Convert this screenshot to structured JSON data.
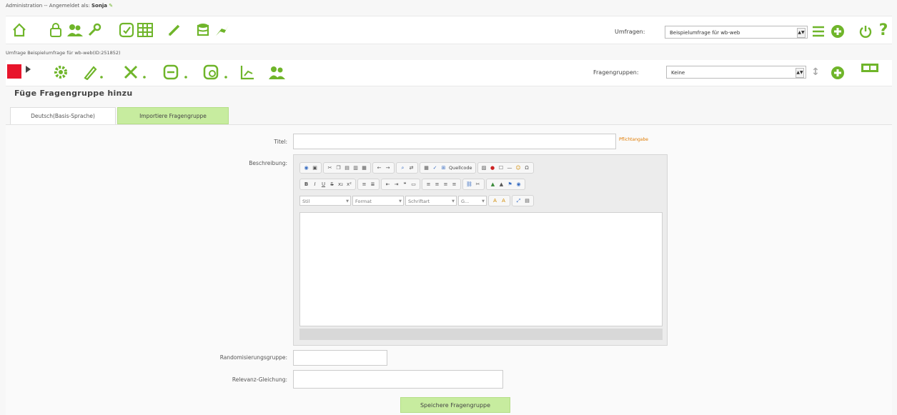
{
  "breadcrumb": {
    "admin": "Administration",
    "separator": " -- ",
    "logged_in_as": "Angemeldet als:",
    "username": "Sonja"
  },
  "toolbar_main": {
    "icons": [
      "home-icon",
      "lock-icon",
      "user-group-icon",
      "wrench-icon",
      "survey-icon",
      "grid-icon",
      "pencil-icon",
      "database-icon",
      "plugin-icon"
    ],
    "surveys_label": "Umfragen:",
    "survey_select": "Beispielumfrage für wb-web",
    "right_icons": [
      "list-icon",
      "add-icon",
      "power-icon",
      "help-icon"
    ]
  },
  "survey_info": "Umfrage Beispielumfrage für wb-web(ID:251852)",
  "toolbar_survey": {
    "icons": [
      "stop-icon",
      "play-icon",
      "settings-icon",
      "edit-icon",
      "tools-icon",
      "survey-group-icon",
      "survey-refresh-icon",
      "chart-icon",
      "people-icon"
    ],
    "groups_label": "Fragengruppen:",
    "group_select": "Keine",
    "right_icons": [
      "reorder-icon",
      "add-group-icon",
      "display-icon"
    ]
  },
  "page_title": "Füge Fragengruppe hinzu",
  "tabs": [
    "Deutsch(Basis-Sprache)",
    "Importiere Fragengruppe"
  ],
  "form": {
    "title_label": "Titel:",
    "required_label": "Pflichtangabe",
    "description_label": "Beschreibung:",
    "randomization_label": "Randomisierungsgruppe:",
    "relevance_label": "Relevanz-Gleichung:",
    "save_button": "Speichere Fragengruppe"
  },
  "editor": {
    "source_label": "Quellcode",
    "style_dd": "Stil",
    "format_dd": "Format",
    "font_dd": "Schriftart",
    "size_dd": "G..."
  }
}
